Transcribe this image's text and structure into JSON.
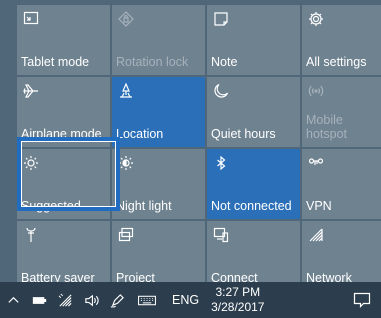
{
  "colors": {
    "background": "#50677a",
    "tile": "#6f8290",
    "tile_active": "#2b6fb9",
    "taskbar": "#2c3e4d",
    "focus": "#1f6cc0"
  },
  "tiles": [
    {
      "label": "Tablet mode",
      "icon": "tablet-mode-icon",
      "state": "off"
    },
    {
      "label": "Rotation lock",
      "icon": "rotation-lock-icon",
      "state": "disabled"
    },
    {
      "label": "Note",
      "icon": "note-icon",
      "state": "off"
    },
    {
      "label": "All settings",
      "icon": "gear-icon",
      "state": "off"
    },
    {
      "label": "Airplane mode",
      "icon": "airplane-icon",
      "state": "off"
    },
    {
      "label": "Location",
      "icon": "location-icon",
      "state": "on"
    },
    {
      "label": "Quiet hours",
      "icon": "moon-icon",
      "state": "off"
    },
    {
      "label": "Mobile\nhotspot",
      "icon": "hotspot-icon",
      "state": "disabled"
    },
    {
      "label": "Suggested",
      "icon": "brightness-icon",
      "state": "focused"
    },
    {
      "label": "Night light",
      "icon": "night-light-icon",
      "state": "off"
    },
    {
      "label": "Not connected",
      "icon": "bluetooth-icon",
      "state": "on"
    },
    {
      "label": "VPN",
      "icon": "vpn-icon",
      "state": "off"
    },
    {
      "label": "Battery saver",
      "icon": "battery-saver-icon",
      "state": "off"
    },
    {
      "label": "Project",
      "icon": "project-icon",
      "state": "off"
    },
    {
      "label": "Connect",
      "icon": "connect-icon",
      "state": "off"
    },
    {
      "label": "Network",
      "icon": "network-icon",
      "state": "off"
    }
  ],
  "taskbar": {
    "icons": [
      "chevron-up-icon",
      "battery-icon",
      "wifi-icon",
      "volume-icon",
      "pen-icon",
      "keyboard-icon"
    ],
    "language": "ENG",
    "time": "3:27 PM",
    "date": "3/28/2017",
    "action_center_icon": "action-center-icon"
  }
}
